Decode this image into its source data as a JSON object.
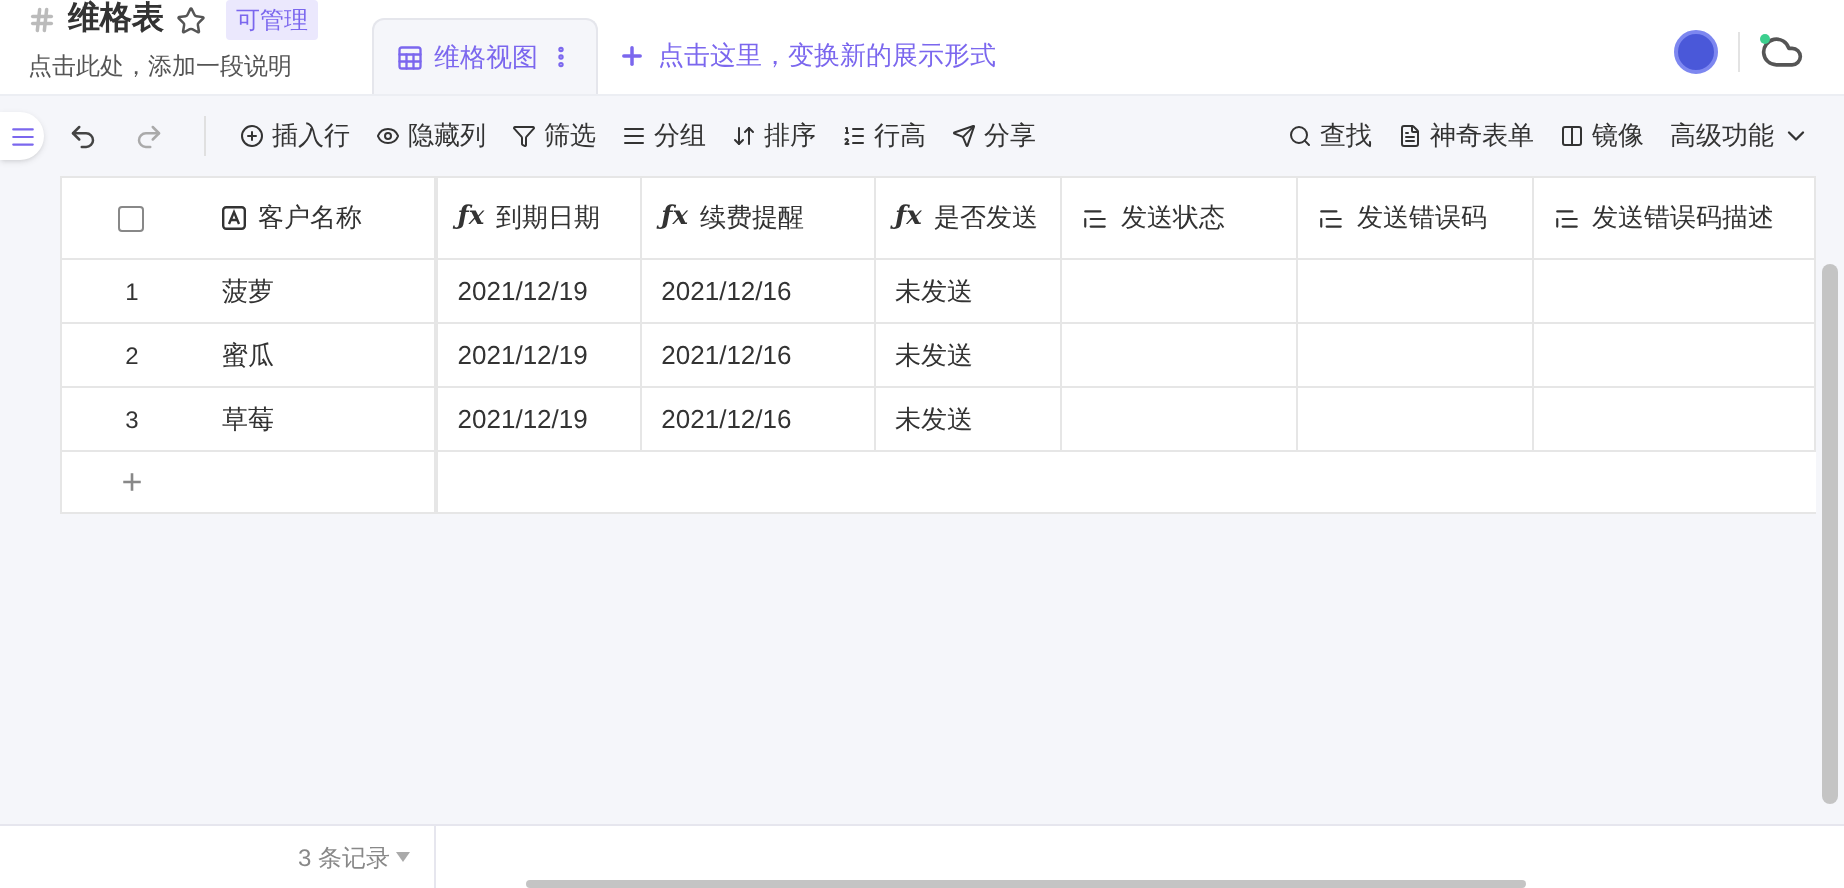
{
  "header": {
    "title": "维格表",
    "starred": false,
    "badge": "可管理",
    "description": "点击此处，添加一段说明",
    "view_tab": {
      "label": "维格视图",
      "selected": true
    },
    "add_view": "点击这里，变换新的展示形式"
  },
  "toolbar": {
    "left": [
      "插入行",
      "隐藏列",
      "筛选",
      "分组",
      "排序",
      "行高",
      "分享"
    ],
    "right": [
      "查找",
      "神奇表单",
      "镜像",
      "高级功能"
    ]
  },
  "table": {
    "select_all_checked": false,
    "columns": [
      {
        "label": "客户名称",
        "kind": "primary"
      },
      {
        "label": "到期日期",
        "kind": "formula",
        "symbol": "ƒx"
      },
      {
        "label": "续费提醒",
        "kind": "formula",
        "symbol": "ƒx"
      },
      {
        "label": "是否发送",
        "kind": "formula",
        "symbol": "ƒx"
      },
      {
        "label": "发送状态",
        "kind": "text"
      },
      {
        "label": "发送错误码",
        "kind": "text"
      },
      {
        "label": "发送错误码描述",
        "kind": "text"
      }
    ],
    "rows": [
      {
        "number": "1",
        "cells": [
          "菠萝",
          "2021/12/19",
          "2021/12/16",
          "未发送"
        ]
      },
      {
        "number": "2",
        "cells": [
          "蜜瓜",
          "2021/12/19",
          "2021/12/16",
          "未发送"
        ]
      },
      {
        "number": "3",
        "cells": [
          "草莓",
          "2021/12/19",
          "2021/12/16",
          "未发送"
        ]
      }
    ],
    "add_row": "+"
  },
  "status_bar": {
    "record_count": "3 条记录"
  }
}
